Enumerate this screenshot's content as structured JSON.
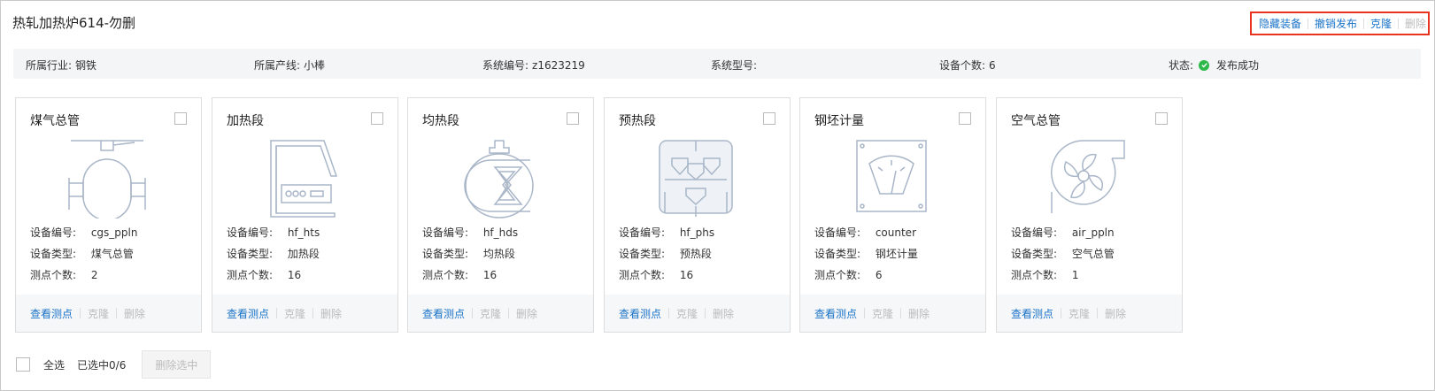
{
  "header": {
    "title": "热轧加热炉614-勿删",
    "actions": [
      {
        "label": "隐藏装备"
      },
      {
        "label": "撤销发布"
      },
      {
        "label": "克隆"
      },
      {
        "label": "删除"
      }
    ]
  },
  "info": {
    "industry": {
      "label": "所属行业:",
      "value": "钢铁"
    },
    "line": {
      "label": "所属产线:",
      "value": "小棒"
    },
    "sys_no": {
      "label": "系统编号:",
      "value": "z1623219"
    },
    "sys_model": {
      "label": "系统型号:",
      "value": ""
    },
    "count": {
      "label": "设备个数:",
      "value": "6"
    },
    "status": {
      "label": "状态:",
      "value": "发布成功",
      "color": "#2eb84a"
    }
  },
  "card_labels": {
    "code": "设备编号:",
    "type": "设备类型:",
    "points": "测点个数:",
    "view": "查看测点",
    "clone": "克隆",
    "delete": "删除"
  },
  "cards": [
    {
      "name": "煤气总管",
      "code": "cgs_ppln",
      "type": "煤气总管",
      "points": "2",
      "icon": "gas-pipeline-icon"
    },
    {
      "name": "加热段",
      "code": "hf_hts",
      "type": "加热段",
      "points": "16",
      "icon": "heating-section-icon"
    },
    {
      "name": "均热段",
      "code": "hf_hds",
      "type": "均热段",
      "points": "16",
      "icon": "soaking-section-icon"
    },
    {
      "name": "预热段",
      "code": "hf_phs",
      "type": "预热段",
      "points": "16",
      "icon": "preheating-section-icon"
    },
    {
      "name": "钢坯计量",
      "code": "counter",
      "type": "钢坯计量",
      "points": "6",
      "icon": "billet-meter-icon"
    },
    {
      "name": "空气总管",
      "code": "air_ppln",
      "type": "空气总管",
      "points": "1",
      "icon": "air-pipeline-icon"
    }
  ],
  "footer": {
    "select_all": "全选",
    "selected": "已选中0/6",
    "delete_selected": "删除选中"
  },
  "colors": {
    "link": "#1a73c8",
    "disabled": "#bbbbbb",
    "highlight_border": "#e8341f"
  }
}
